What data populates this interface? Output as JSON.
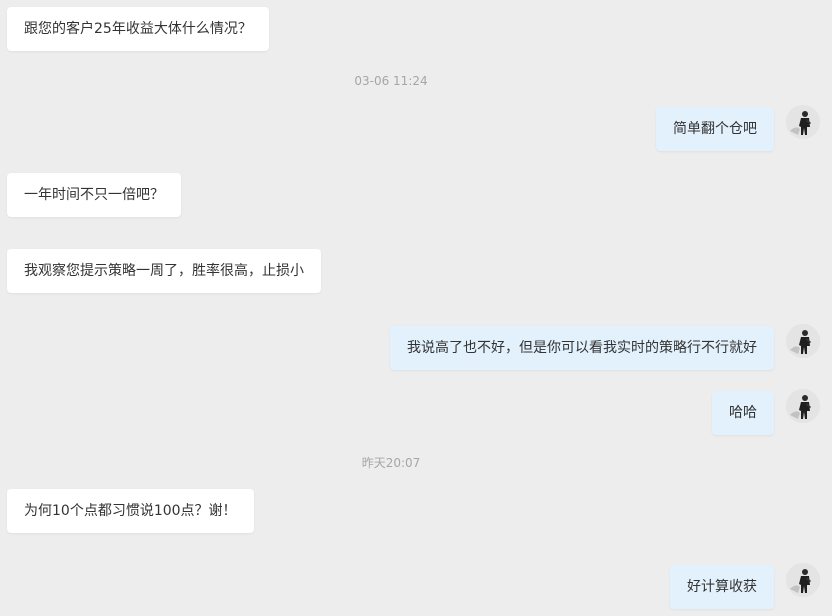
{
  "messages": [
    {
      "side": "in",
      "text": "跟您的客户25年收益大体什么情况？"
    },
    {
      "side": "out",
      "text": "简单翻个仓吧"
    },
    {
      "side": "in",
      "text": "一年时间不只一倍吧？"
    },
    {
      "side": "in",
      "text": "我观察您提示策略一周了，胜率很高，止损小"
    },
    {
      "side": "out",
      "text": "我说高了也不好，但是你可以看我实时的策略行不行就好"
    },
    {
      "side": "out",
      "text": "哈哈"
    },
    {
      "side": "in",
      "text": "为何10个点都习惯说100点？谢！"
    },
    {
      "side": "out",
      "text": "好计算收获"
    }
  ],
  "timestamps": [
    "03-06 11:24",
    "昨天20:07"
  ],
  "colors": {
    "background": "#ededed",
    "incoming_bubble": "#ffffff",
    "outgoing_bubble": "#e3f1fc",
    "timestamp_text": "#a6a6a6"
  },
  "icons": {
    "avatar": "user-avatar-icon"
  }
}
